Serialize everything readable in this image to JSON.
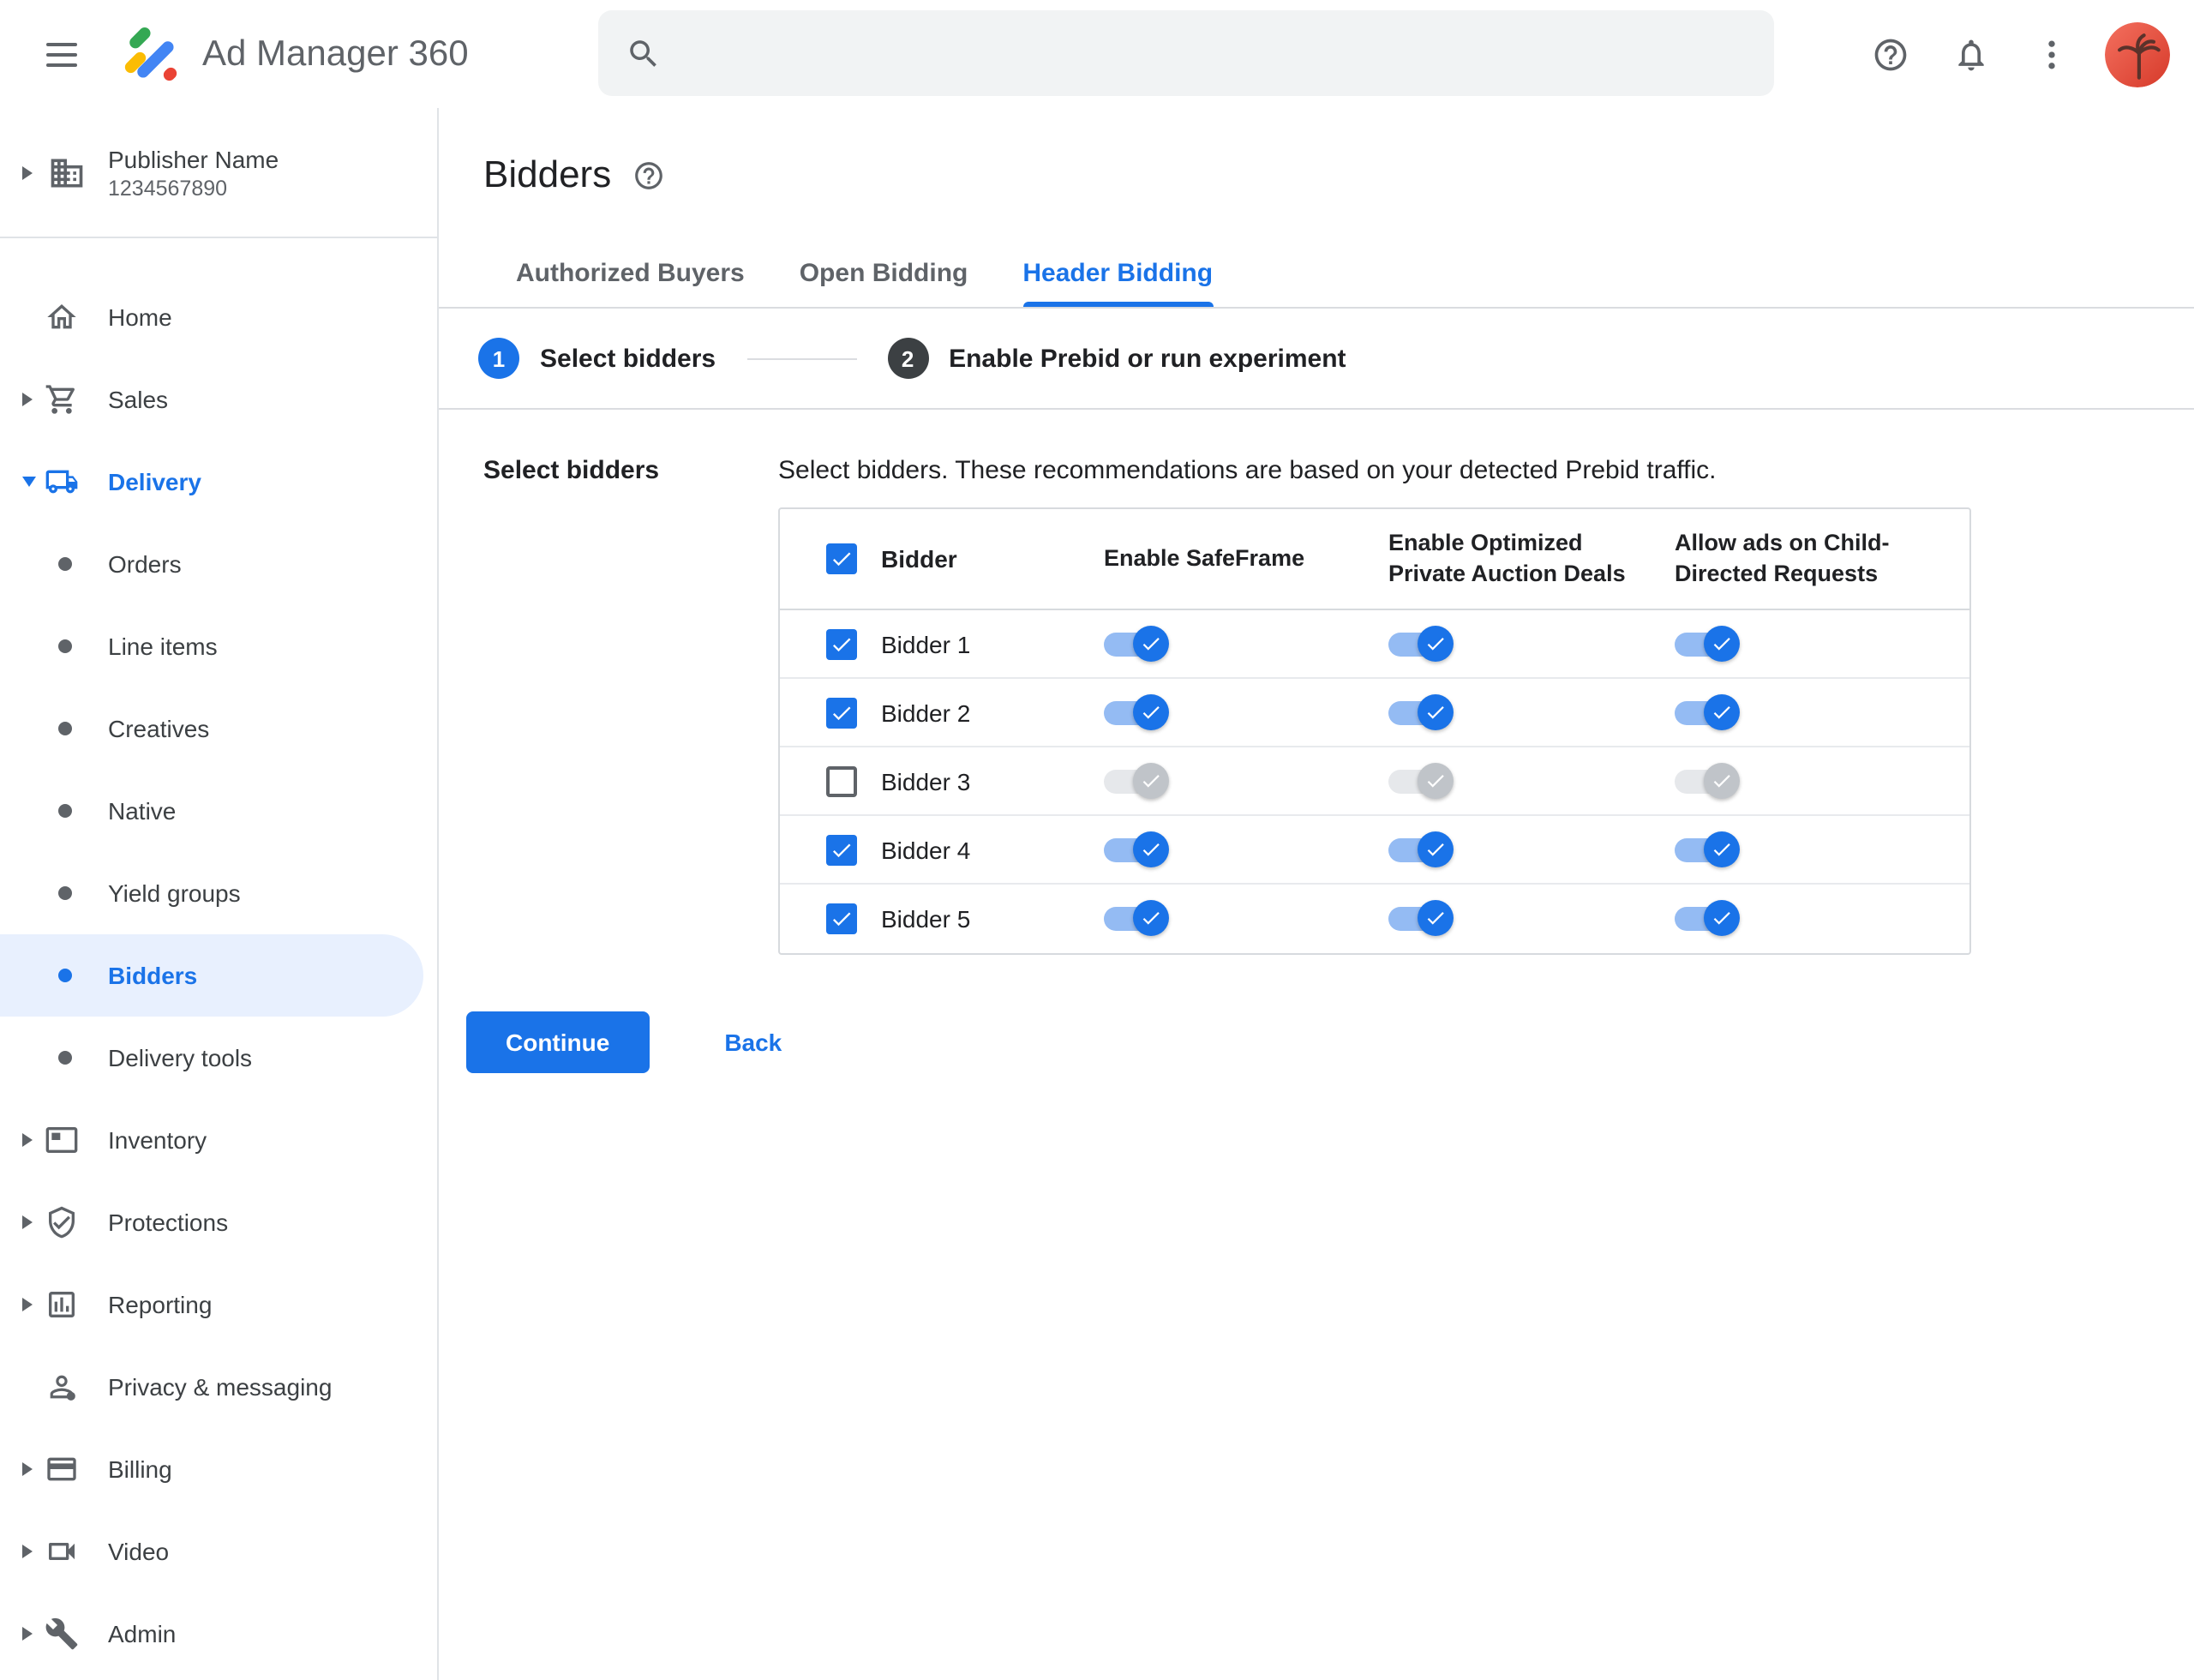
{
  "topbar": {
    "product_name": "Ad Manager 360",
    "search": {
      "value": "",
      "placeholder": ""
    }
  },
  "sidebar": {
    "publisher": {
      "name": "Publisher Name",
      "id": "1234567890"
    },
    "items": [
      {
        "id": "home",
        "label": "Home",
        "icon": "home",
        "arrow": null
      },
      {
        "id": "sales",
        "label": "Sales",
        "icon": "cart",
        "arrow": "right"
      },
      {
        "id": "delivery",
        "label": "Delivery",
        "icon": "truck",
        "arrow": "down",
        "active_parent": true
      },
      {
        "id": "orders",
        "label": "Orders",
        "bullet": true
      },
      {
        "id": "line-items",
        "label": "Line items",
        "bullet": true
      },
      {
        "id": "creatives",
        "label": "Creatives",
        "bullet": true
      },
      {
        "id": "native",
        "label": "Native",
        "bullet": true
      },
      {
        "id": "yield-groups",
        "label": "Yield groups",
        "bullet": true
      },
      {
        "id": "bidders",
        "label": "Bidders",
        "bullet": true,
        "selected": true
      },
      {
        "id": "delivery-tools",
        "label": "Delivery tools",
        "bullet": true
      },
      {
        "id": "inventory",
        "label": "Inventory",
        "icon": "inventory",
        "arrow": "right"
      },
      {
        "id": "protections",
        "label": "Protections",
        "icon": "shield",
        "arrow": "right"
      },
      {
        "id": "reporting",
        "label": "Reporting",
        "icon": "chart",
        "arrow": "right"
      },
      {
        "id": "privacy-messaging",
        "label": "Privacy & messaging",
        "icon": "person",
        "arrow": null
      },
      {
        "id": "billing",
        "label": "Billing",
        "icon": "card",
        "arrow": "right"
      },
      {
        "id": "video",
        "label": "Video",
        "icon": "video",
        "arrow": "right"
      },
      {
        "id": "admin",
        "label": "Admin",
        "icon": "wrench",
        "arrow": "right"
      }
    ]
  },
  "main": {
    "title": "Bidders",
    "tabs": [
      {
        "label": "Authorized Buyers",
        "active": false
      },
      {
        "label": "Open Bidding",
        "active": false
      },
      {
        "label": "Header Bidding",
        "active": true
      }
    ],
    "stepper": [
      {
        "number": "1",
        "label": "Select bidders",
        "state": "active"
      },
      {
        "number": "2",
        "label": "Enable Prebid or run experiment",
        "state": "upcoming"
      }
    ],
    "section_label": "Select bidders",
    "description": "Select bidders. These recommendations are based on your detected Prebid traffic.",
    "table": {
      "columns": [
        "Bidder",
        "Enable SafeFrame",
        "Enable Optimized Private Auction Deals",
        "Allow ads on Child-Directed Requests"
      ],
      "select_all_checked": true,
      "rows": [
        {
          "name": "Bidder 1",
          "checked": true,
          "toggles": [
            true,
            true,
            true
          ]
        },
        {
          "name": "Bidder 2",
          "checked": true,
          "toggles": [
            true,
            true,
            true
          ]
        },
        {
          "name": "Bidder 3",
          "checked": false,
          "toggles": [
            false,
            false,
            false
          ]
        },
        {
          "name": "Bidder 4",
          "checked": true,
          "toggles": [
            true,
            true,
            true
          ]
        },
        {
          "name": "Bidder 5",
          "checked": true,
          "toggles": [
            true,
            true,
            true
          ]
        }
      ]
    },
    "continue_label": "Continue",
    "back_label": "Back"
  },
  "colors": {
    "accent": "#1a73e8",
    "selected_bg": "#e8f0fe",
    "text_primary": "#202124",
    "text_secondary": "#5f6368",
    "border": "#dadce0",
    "toggle_on_track": "#94bbf3",
    "toggle_off_track": "#e6e8eb",
    "step_upcoming_circle": "#3c4043"
  }
}
